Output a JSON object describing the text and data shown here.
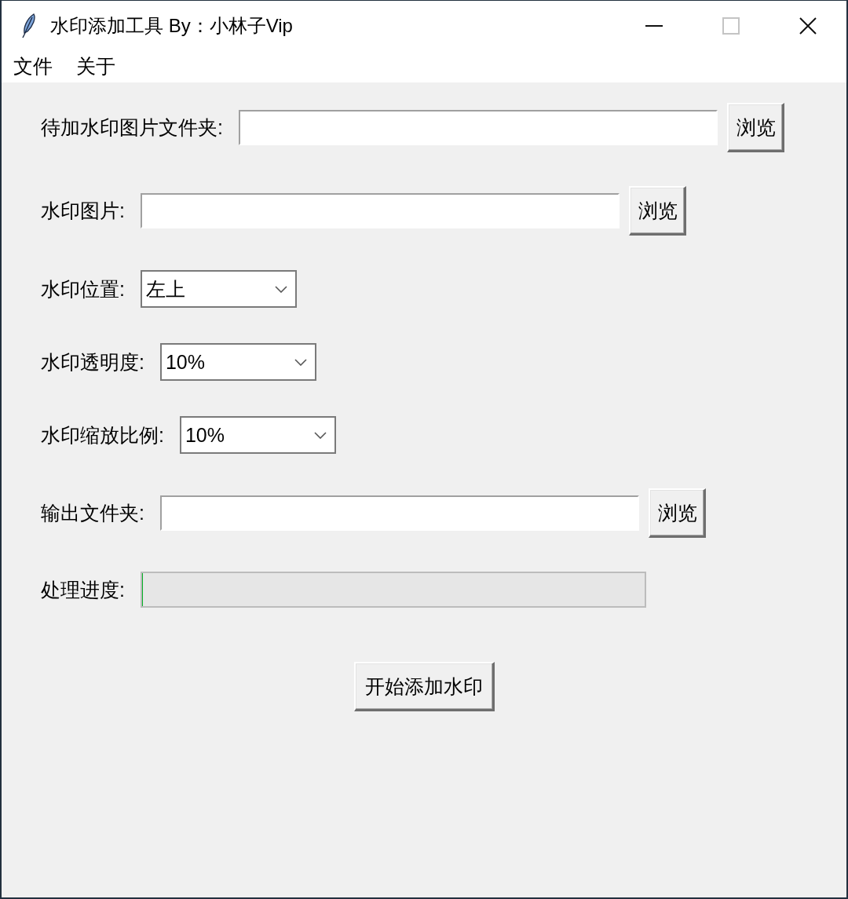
{
  "window": {
    "title": "水印添加工具 By：小林子Vip",
    "controls": [
      {
        "kind": "minimize",
        "disabled": false
      },
      {
        "kind": "maximize",
        "disabled": true
      },
      {
        "kind": "close",
        "disabled": false
      }
    ]
  },
  "menu": [
    "文件",
    "关于"
  ],
  "form": {
    "rows": [
      {
        "kind": "entry",
        "label": "待加水印图片文件夹:",
        "button": "浏览"
      },
      {
        "kind": "entry",
        "label": "水印图片:",
        "button": "浏览"
      },
      {
        "kind": "combobox",
        "label": "水印位置:",
        "value": "左上"
      },
      {
        "kind": "combobox",
        "label": "水印透明度:",
        "value": "10%"
      },
      {
        "kind": "combobox",
        "label": "水印缩放比例:",
        "value": "10%"
      },
      {
        "kind": "entry",
        "label": "输出文件夹:",
        "button": "浏览"
      },
      {
        "kind": "progress",
        "label": "处理进度:",
        "level": 0
      }
    ]
  },
  "start_button": "开始添加水印"
}
